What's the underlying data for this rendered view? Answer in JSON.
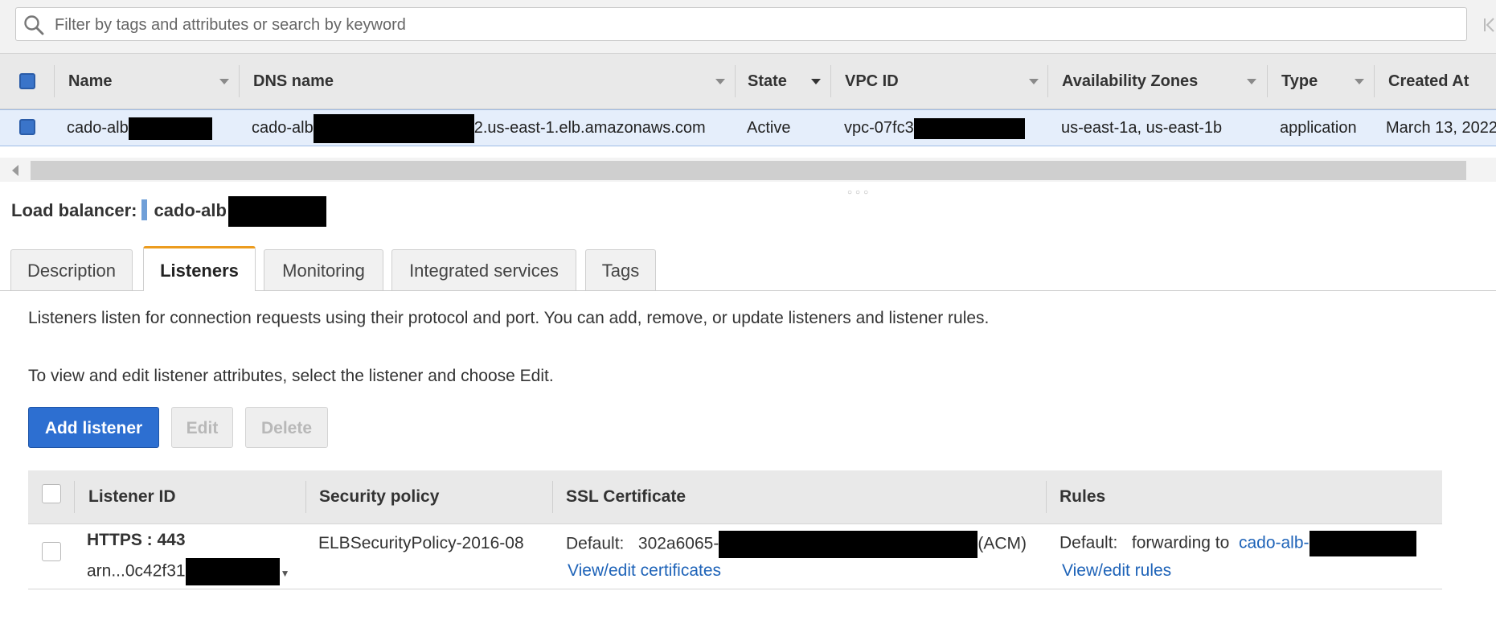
{
  "search": {
    "placeholder": "Filter by tags and attributes or search by keyword"
  },
  "lb_table": {
    "columns": [
      "Name",
      "DNS name",
      "State",
      "VPC ID",
      "Availability Zones",
      "Type",
      "Created At"
    ],
    "row": {
      "name": "cado-alb",
      "dns_prefix": "cado-alb",
      "dns_suffix": "2.us-east-1.elb.amazonaws.com",
      "state": "Active",
      "vpc_id": "vpc-07fc3",
      "availability_zones": "us-east-1a, us-east-1b",
      "type": "application",
      "created_at": "March 13, 2022"
    }
  },
  "details": {
    "title_label": "Load balancer:",
    "title_name": "cado-alb",
    "tabs": [
      "Description",
      "Listeners",
      "Monitoring",
      "Integrated services",
      "Tags"
    ],
    "active_tab": "Listeners",
    "description": "Listeners listen for connection requests using their protocol and port. You can add, remove, or update listeners and listener rules.",
    "instruction": "To view and edit listener attributes, select the listener and choose Edit.",
    "buttons": {
      "add": "Add listener",
      "edit": "Edit",
      "delete": "Delete"
    }
  },
  "listeners_table": {
    "columns": [
      "Listener ID",
      "Security policy",
      "SSL Certificate",
      "Rules"
    ],
    "row": {
      "listener": "HTTPS : 443",
      "arn": "arn...0c42f31",
      "security_policy": "ELBSecurityPolicy-2016-08",
      "cert_label": "Default:",
      "cert_id": "302a6065-",
      "cert_suffix": "(ACM)",
      "cert_link": "View/edit certificates",
      "rules_label": "Default:",
      "rules_text": "forwarding to",
      "rules_target": "cado-alb-",
      "rules_link": "View/edit rules"
    }
  },
  "colors": {
    "accent_blue": "#2d6fd1",
    "tab_active_border": "#ec9c1f",
    "link": "#1e63b8",
    "row_selected": "#e5eefb"
  }
}
